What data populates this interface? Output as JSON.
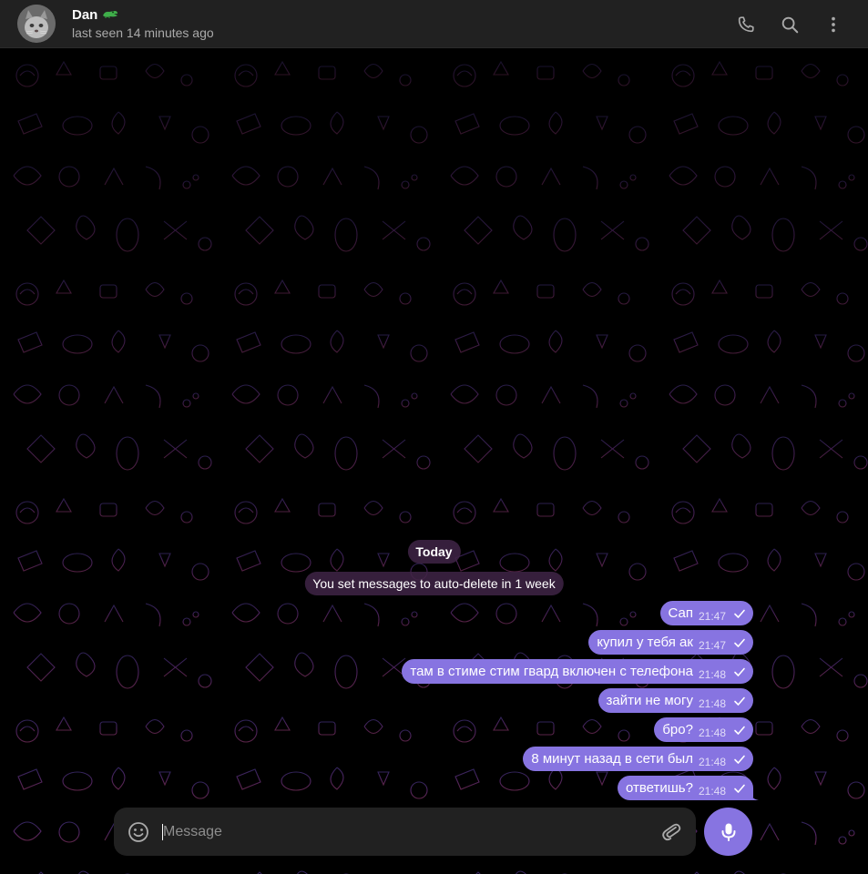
{
  "header": {
    "peer_name": "Dan",
    "peer_emoji_icon": "green-crocodile-emoji-icon",
    "peer_status": "last seen 14 minutes ago",
    "actions": [
      "phone-icon",
      "search-icon",
      "more-vertical-icon"
    ]
  },
  "service": {
    "date_label": "Today",
    "auto_delete": "You set messages to auto-delete in 1 week"
  },
  "messages": [
    {
      "text": "Сап",
      "time": "21:47"
    },
    {
      "text": "купил у тебя ак",
      "time": "21:47"
    },
    {
      "text": "там в стиме стим гвард включен с телефона",
      "time": "21:48"
    },
    {
      "text": "зайти не могу",
      "time": "21:48"
    },
    {
      "text": "бро?",
      "time": "21:48"
    },
    {
      "text": "8 минут назад в сети был",
      "time": "21:48"
    },
    {
      "text": "ответишь?",
      "time": "21:48"
    }
  ],
  "composer": {
    "placeholder": "Message"
  },
  "colors": {
    "accent": "#8774e1",
    "header_bg": "#212121",
    "chat_bg": "#000000",
    "service_bg": "#402446"
  }
}
